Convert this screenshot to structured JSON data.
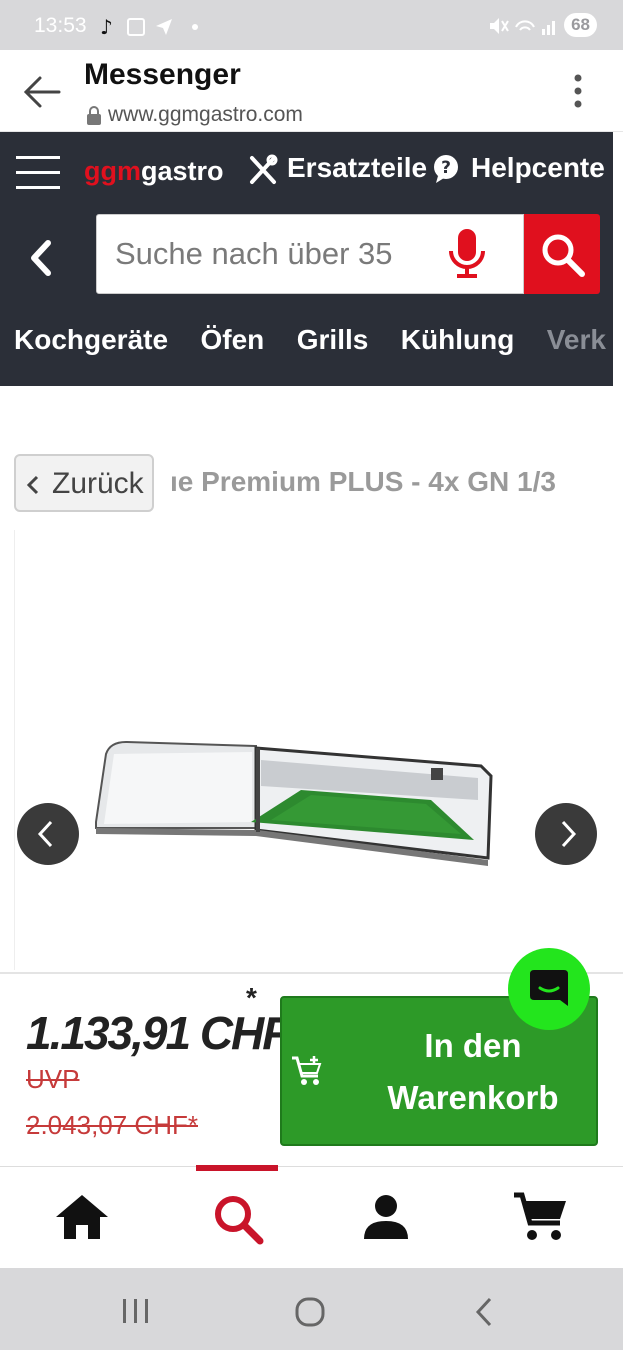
{
  "status_bar": {
    "time": "13:53",
    "battery": "68"
  },
  "browser": {
    "title": "Messenger",
    "url": "www.ggmgastro.com"
  },
  "header": {
    "logo_part1": "ggm",
    "logo_part2": "gastro",
    "link_spare_parts": "Ersatzteile",
    "link_help": "Helpcente",
    "search_placeholder": "Suche nach über 35",
    "categories": [
      "Kochgeräte",
      "Öfen",
      "Grills",
      "Kühlung",
      "Verk"
    ]
  },
  "product": {
    "back_label": "Zurück",
    "title": "ıe Premium PLUS - 4x GN 1/3"
  },
  "price_panel": {
    "price": "1.133,91 CHF",
    "price_star": "*",
    "uvp_label": "UVP",
    "old_price": "2.043,07 CHF*",
    "cart_line1": "In den",
    "cart_line2": "Warenkorb"
  },
  "colors": {
    "brand_red": "#e0101e",
    "header_bg": "#2b2f38",
    "cart_green": "#2d9a28",
    "chat_green": "#23e51d"
  }
}
